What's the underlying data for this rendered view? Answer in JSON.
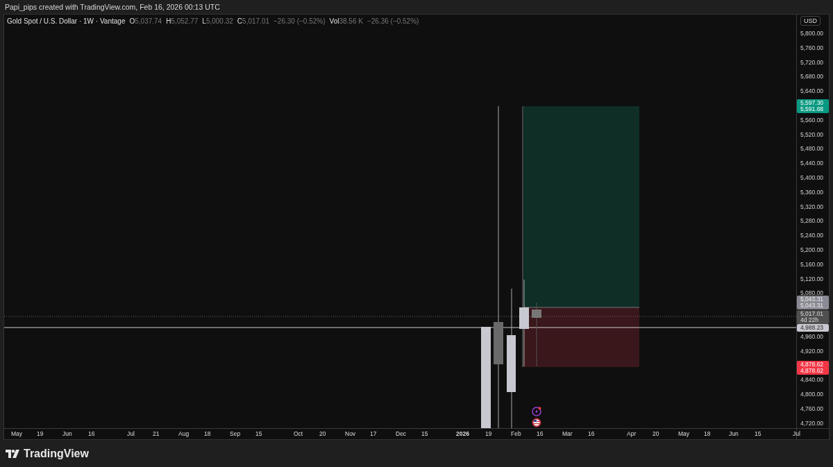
{
  "header": {
    "credit": "Papi_pips created with TradingView.com, Feb 16, 2026 00:13 UTC"
  },
  "legend": {
    "symbol": "Gold Spot / U.S. Dollar · 1W · Vantage",
    "fields": [
      {
        "label": "O",
        "value": "5,037.74"
      },
      {
        "label": "H",
        "value": "5,052.77"
      },
      {
        "label": "L",
        "value": "5,000.32"
      },
      {
        "label": "C",
        "value": "5,017.01"
      }
    ],
    "change": "−26.30 (−0.52%)",
    "volume": {
      "label": "Vol",
      "value": "38.56 K",
      "change": "−26.36 (−0.52%)"
    }
  },
  "price_axis": {
    "currency": "USD",
    "ticks": [
      "5,800.00",
      "5,760.00",
      "5,720.00",
      "5,680.00",
      "5,640.00",
      "5,560.00",
      "5,520.00",
      "5,480.00",
      "5,440.00",
      "5,400.00",
      "5,360.00",
      "5,320.00",
      "5,280.00",
      "5,240.00",
      "5,200.00",
      "5,160.00",
      "5,120.00",
      "5,080.00",
      "4,960.00",
      "4,920.00",
      "4,840.00",
      "4,800.00",
      "4,760.00",
      "4,720.00"
    ],
    "badges": [
      {
        "kind": "target",
        "lines": [
          "5,597.30",
          "5,591.68"
        ]
      },
      {
        "kind": "entry",
        "lines": [
          "5,043.31",
          "5,043.31"
        ]
      },
      {
        "kind": "last",
        "lines": [
          "5,017.01",
          "4d 22h"
        ]
      },
      {
        "kind": "line",
        "lines": [
          "4,988.23"
        ]
      },
      {
        "kind": "stop",
        "lines": [
          "4,878.62",
          "4,878.62"
        ]
      }
    ]
  },
  "time_axis": {
    "labels": [
      {
        "text": "May",
        "kind": "month"
      },
      {
        "text": "19",
        "kind": "day"
      },
      {
        "text": "Jun",
        "kind": "month"
      },
      {
        "text": "16",
        "kind": "day"
      },
      {
        "text": "Jul",
        "kind": "month"
      },
      {
        "text": "21",
        "kind": "day"
      },
      {
        "text": "Aug",
        "kind": "month"
      },
      {
        "text": "18",
        "kind": "day"
      },
      {
        "text": "Sep",
        "kind": "month"
      },
      {
        "text": "15",
        "kind": "day"
      },
      {
        "text": "Oct",
        "kind": "month"
      },
      {
        "text": "20",
        "kind": "day"
      },
      {
        "text": "Nov",
        "kind": "month"
      },
      {
        "text": "17",
        "kind": "day"
      },
      {
        "text": "Dec",
        "kind": "month"
      },
      {
        "text": "15",
        "kind": "day"
      },
      {
        "text": "2026",
        "kind": "year"
      },
      {
        "text": "19",
        "kind": "day"
      },
      {
        "text": "Feb",
        "kind": "month"
      },
      {
        "text": "16",
        "kind": "day"
      },
      {
        "text": "Mar",
        "kind": "month"
      },
      {
        "text": "16",
        "kind": "day"
      },
      {
        "text": "Apr",
        "kind": "month"
      },
      {
        "text": "20",
        "kind": "day"
      },
      {
        "text": "May",
        "kind": "month"
      },
      {
        "text": "18",
        "kind": "day"
      },
      {
        "text": "Jun",
        "kind": "month"
      },
      {
        "text": "15",
        "kind": "day"
      },
      {
        "text": "Jul",
        "kind": "month"
      }
    ]
  },
  "footer": {
    "brand": "TradingView"
  }
}
